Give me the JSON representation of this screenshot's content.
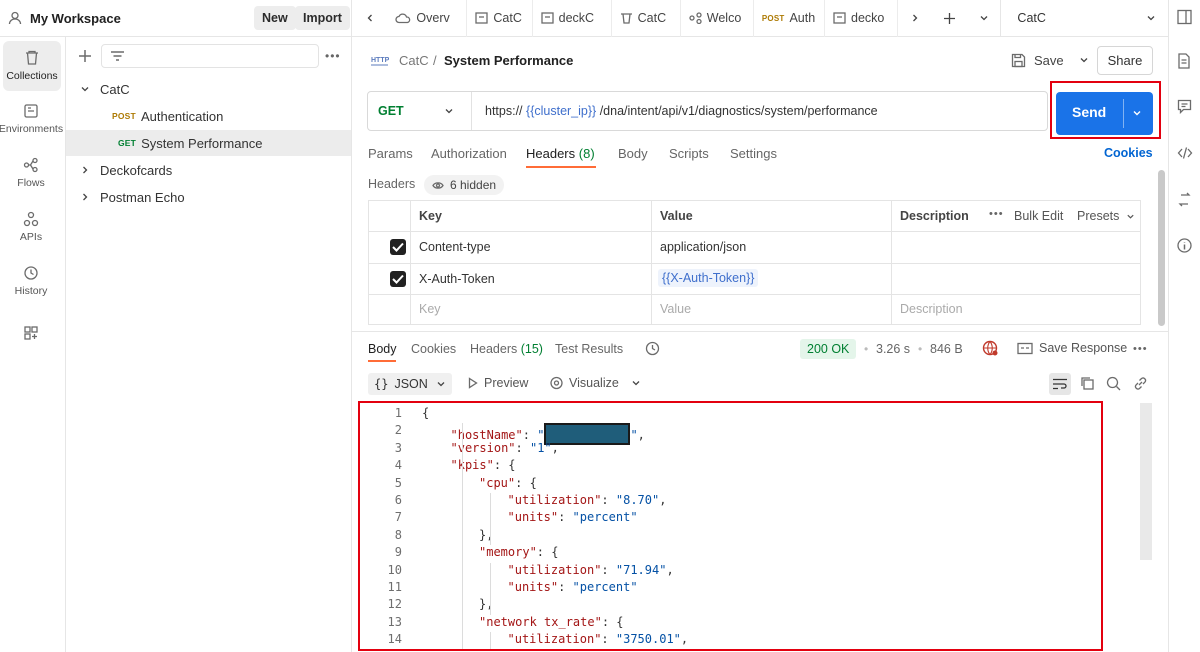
{
  "workspace": {
    "title": "My Workspace",
    "new_label": "New",
    "import_label": "Import"
  },
  "rail": [
    {
      "label": "Collections",
      "icon": "trash-can-icon"
    },
    {
      "label": "Environments",
      "icon": "environment-icon"
    },
    {
      "label": "Flows",
      "icon": "flows-icon"
    },
    {
      "label": "APIs",
      "icon": "apis-icon"
    },
    {
      "label": "History",
      "icon": "history-icon"
    }
  ],
  "tree": {
    "catc": "CatC",
    "auth_method": "POST",
    "auth_label": "Authentication",
    "perf_method": "GET",
    "perf_label": "System Performance",
    "deck": "Deckofcards",
    "echo": "Postman Echo"
  },
  "tabs": [
    {
      "label": "Overv"
    },
    {
      "label": "CatC"
    },
    {
      "label": "deckC"
    },
    {
      "label": "CatC"
    },
    {
      "label": "Welco"
    },
    {
      "label": "Auth",
      "method": "POST"
    },
    {
      "label": "decko"
    }
  ],
  "env": {
    "selected": "CatC"
  },
  "request": {
    "breadcrumb_parent": "CatC",
    "breadcrumb_sep": "/",
    "title": "System Performance",
    "save_label": "Save",
    "share_label": "Share",
    "method": "GET",
    "url_prefix": "https://",
    "url_var": "{{cluster_ip}}",
    "url_path": "/dna/intent/api/v1/diagnostics/system/performance",
    "send_label": "Send",
    "tabs": [
      "Params",
      "Authorization",
      "Headers",
      "(8)",
      "Body",
      "Scripts",
      "Settings"
    ],
    "cookies_label": "Cookies",
    "headers_label": "Headers",
    "hidden_label": "6 hidden",
    "table": {
      "col_key": "Key",
      "col_value": "Value",
      "col_desc": "Description",
      "bulk_edit": "Bulk Edit",
      "presets": "Presets",
      "rows": [
        {
          "key": "Content-type",
          "value": "application/json"
        },
        {
          "key": "X-Auth-Token",
          "value": "{{X-Auth-Token}}"
        }
      ],
      "ph_key": "Key",
      "ph_value": "Value",
      "ph_desc": "Description"
    }
  },
  "response": {
    "tabs": [
      "Body",
      "Cookies",
      "Headers",
      "(15)",
      "Test Results"
    ],
    "status": "200 OK",
    "time": "3.26 s",
    "size": "846 B",
    "save_response": "Save Response",
    "format": "JSON",
    "preview": "Preview",
    "visualize": "Visualize",
    "lines": [
      {
        "n": "1",
        "indent": 0,
        "parts": [
          [
            "p",
            "{"
          ]
        ]
      },
      {
        "n": "2",
        "indent": 1,
        "parts": [
          [
            "k",
            "\"hostName\""
          ],
          [
            "p",
            ": "
          ],
          [
            "s",
            "\""
          ],
          [
            "redact",
            ""
          ],
          [
            "s",
            "\""
          ],
          [
            "p",
            ","
          ]
        ]
      },
      {
        "n": "3",
        "indent": 1,
        "parts": [
          [
            "k",
            "\"version\""
          ],
          [
            "p",
            ": "
          ],
          [
            "s",
            "\"1\""
          ],
          [
            "p",
            ","
          ]
        ]
      },
      {
        "n": "4",
        "indent": 1,
        "parts": [
          [
            "k",
            "\"kpis\""
          ],
          [
            "p",
            ": {"
          ]
        ]
      },
      {
        "n": "5",
        "indent": 2,
        "parts": [
          [
            "k",
            "\"cpu\""
          ],
          [
            "p",
            ": {"
          ]
        ]
      },
      {
        "n": "6",
        "indent": 3,
        "parts": [
          [
            "k",
            "\"utilization\""
          ],
          [
            "p",
            ": "
          ],
          [
            "s",
            "\"8.70\""
          ],
          [
            "p",
            ","
          ]
        ]
      },
      {
        "n": "7",
        "indent": 3,
        "parts": [
          [
            "k",
            "\"units\""
          ],
          [
            "p",
            ": "
          ],
          [
            "s",
            "\"percent\""
          ]
        ]
      },
      {
        "n": "8",
        "indent": 2,
        "parts": [
          [
            "p",
            "},"
          ]
        ]
      },
      {
        "n": "9",
        "indent": 2,
        "parts": [
          [
            "k",
            "\"memory\""
          ],
          [
            "p",
            ": {"
          ]
        ]
      },
      {
        "n": "10",
        "indent": 3,
        "parts": [
          [
            "k",
            "\"utilization\""
          ],
          [
            "p",
            ": "
          ],
          [
            "s",
            "\"71.94\""
          ],
          [
            "p",
            ","
          ]
        ]
      },
      {
        "n": "11",
        "indent": 3,
        "parts": [
          [
            "k",
            "\"units\""
          ],
          [
            "p",
            ": "
          ],
          [
            "s",
            "\"percent\""
          ]
        ]
      },
      {
        "n": "12",
        "indent": 2,
        "parts": [
          [
            "p",
            "},"
          ]
        ]
      },
      {
        "n": "13",
        "indent": 2,
        "parts": [
          [
            "k",
            "\"network tx_rate\""
          ],
          [
            "p",
            ": {"
          ]
        ]
      },
      {
        "n": "14",
        "indent": 3,
        "parts": [
          [
            "k",
            "\"utilization\""
          ],
          [
            "p",
            ": "
          ],
          [
            "s",
            "\"3750.01\""
          ],
          [
            "p",
            ","
          ]
        ]
      }
    ]
  },
  "colors": {
    "accent": "#0265d2",
    "send": "#1a73e8",
    "highlight": "#e3000f",
    "status_ok": "#007f31"
  }
}
